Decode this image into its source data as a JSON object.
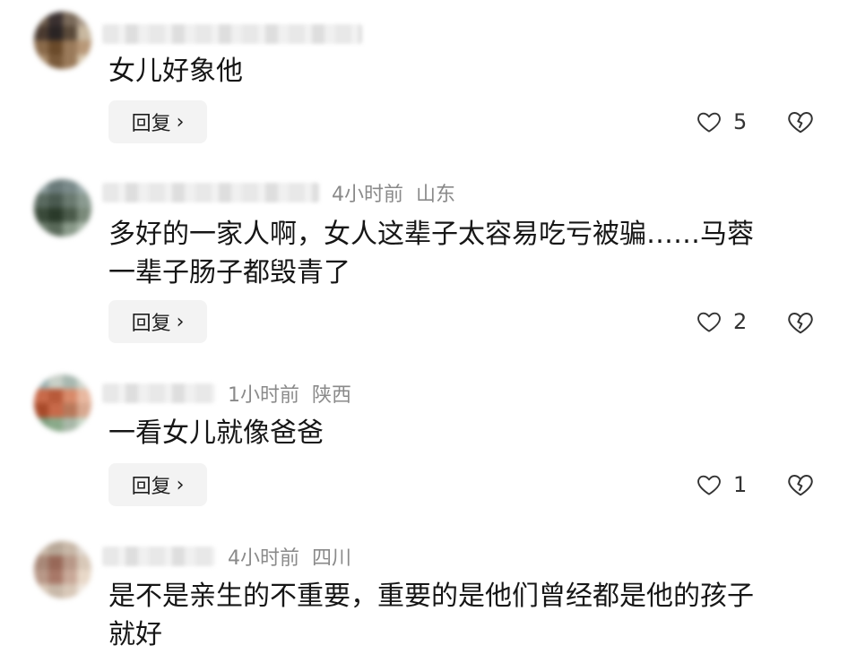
{
  "reply_label": "回复",
  "chevron_glyph": "›",
  "comments": [
    {
      "time": "",
      "location": "",
      "text": "女儿好象他",
      "likes": "5"
    },
    {
      "time": "4小时前",
      "location": "山东",
      "text": "多好的一家人啊，女人这辈子太容易吃亏被骗……马蓉\n一辈子肠子都毁青了",
      "likes": "2"
    },
    {
      "time": "1小时前",
      "location": "陕西",
      "text": "一看女儿就像爸爸",
      "likes": "1"
    },
    {
      "time": "4小时前",
      "location": "四川",
      "text": "是不是亲生的不重要，重要的是他们曾经都是他的孩子\n就好",
      "likes": ""
    }
  ],
  "icons": {
    "like": "heart-outline-icon",
    "dislike": "broken-heart-icon",
    "reply_arrow": "chevron-right-icon"
  }
}
